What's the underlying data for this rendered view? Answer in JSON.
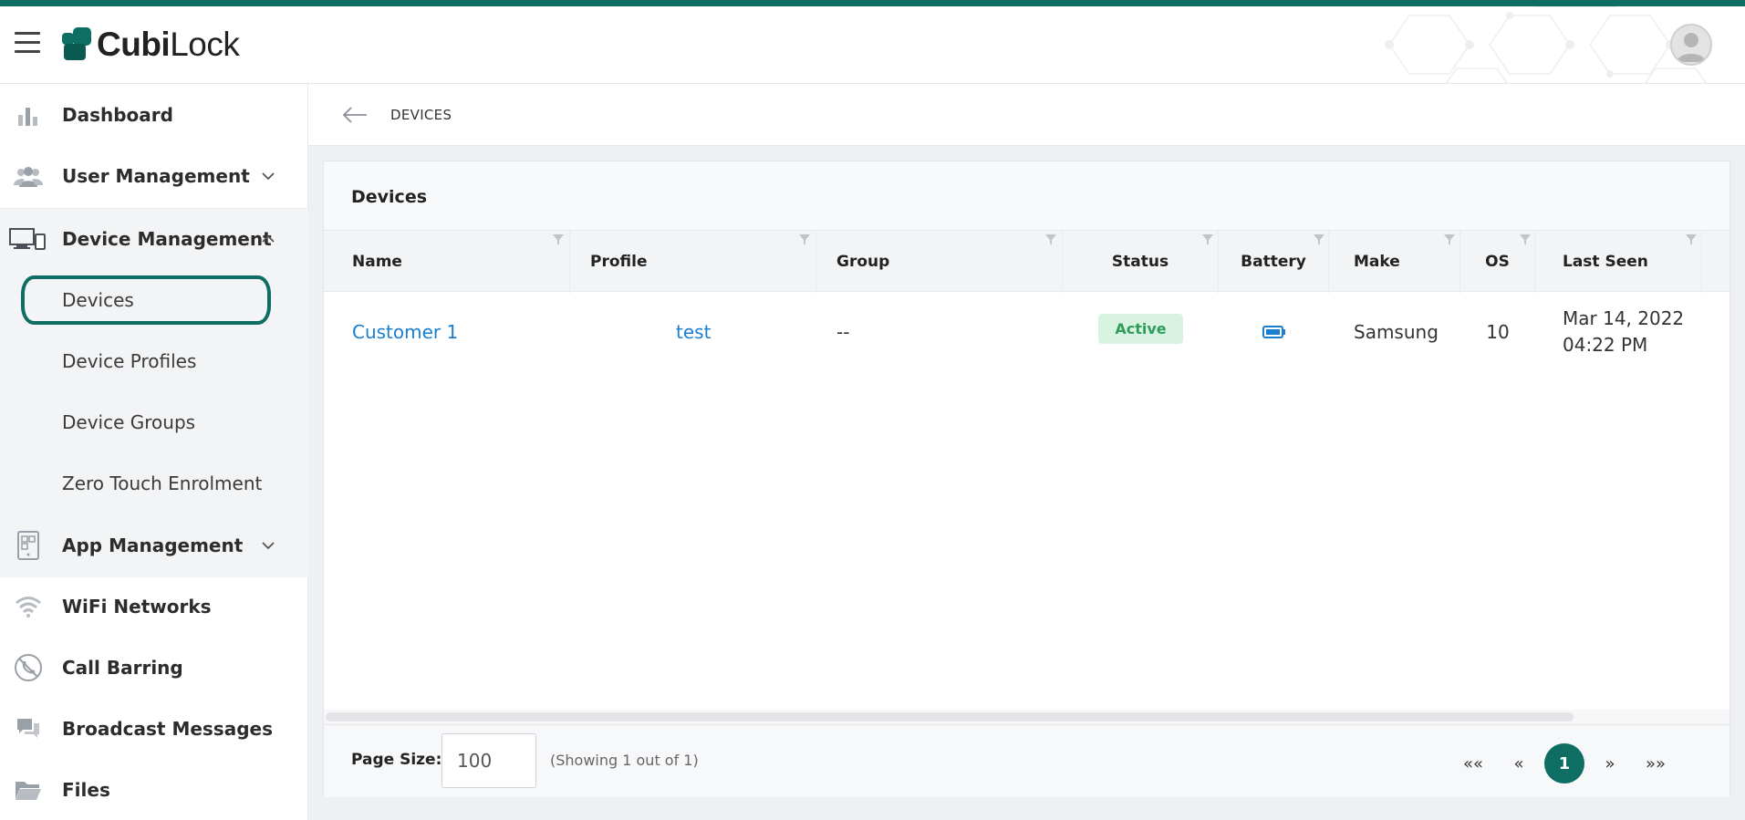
{
  "brand": {
    "logo_bold": "Cubi",
    "logo_light": "Lock",
    "accent_color": "#0e6e63"
  },
  "sidebar": {
    "items": [
      {
        "label": "Dashboard",
        "icon": "bar-chart-icon"
      },
      {
        "label": "User Management",
        "icon": "users-icon",
        "expandable": true,
        "expanded": false
      },
      {
        "label": "Device Management",
        "icon": "devices-icon",
        "expandable": true,
        "expanded": true
      },
      {
        "label": "App Management",
        "icon": "app-icon",
        "expandable": true,
        "expanded": false
      },
      {
        "label": "WiFi Networks",
        "icon": "wifi-icon"
      },
      {
        "label": "Call Barring",
        "icon": "phone-barred-icon"
      },
      {
        "label": "Broadcast Messages",
        "icon": "chat-icon"
      },
      {
        "label": "Files",
        "icon": "folder-icon"
      }
    ],
    "device_submenu": [
      {
        "label": "Devices",
        "active": true
      },
      {
        "label": "Device Profiles"
      },
      {
        "label": "Device Groups"
      },
      {
        "label": "Zero Touch Enrolment"
      }
    ]
  },
  "breadcrumb": {
    "current": "DEVICES"
  },
  "card": {
    "title": "Devices"
  },
  "table": {
    "columns": [
      "Name",
      "Profile",
      "Group",
      "Status",
      "Battery",
      "Make",
      "OS",
      "Last Seen"
    ],
    "rows": [
      {
        "name": "Customer 1",
        "profile": "test",
        "group": "--",
        "status": "Active",
        "battery_icon": "battery-icon",
        "make": "Samsung",
        "os": "10",
        "last_seen_date": "Mar 14, 2022",
        "last_seen_time": "04:22 PM"
      }
    ]
  },
  "footer": {
    "page_size_label": "Page Size:",
    "page_size_value": "100",
    "showing_text": "(Showing 1 out of 1)",
    "pagination": {
      "first": "««",
      "prev": "«",
      "current": "1",
      "next": "»",
      "last": "»»"
    }
  }
}
